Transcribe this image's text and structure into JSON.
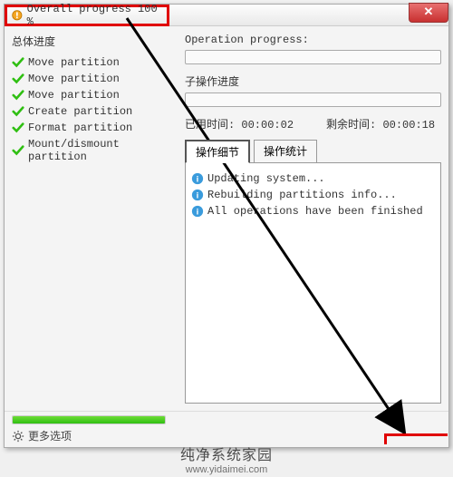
{
  "window": {
    "title": "Overall progress 100 %",
    "close_label": "✕"
  },
  "left": {
    "heading": "总体进度",
    "ops": [
      "Move partition",
      "Move partition",
      "Move partition",
      "Create partition",
      "Format partition",
      "Mount/dismount partition"
    ]
  },
  "right": {
    "op_progress_label": "Operation progress:",
    "sub_progress_label": "子操作进度",
    "elapsed_label": "已用时间:",
    "elapsed_value": "00:00:02",
    "remaining_label": "剩余时间:",
    "remaining_value": "00:00:18",
    "tabs": {
      "active": "操作细节",
      "inactive": "操作统计"
    },
    "details": [
      "Updating system...",
      "Rebuilding partitions info...",
      "All operations have been finished"
    ]
  },
  "bottom": {
    "more_options": "更多选项"
  },
  "watermark": {
    "text": "纯净系统家园",
    "url": "www.yidaimei.com"
  },
  "colors": {
    "highlight_red": "#e00000",
    "progress_green": "#3bbf1a"
  }
}
